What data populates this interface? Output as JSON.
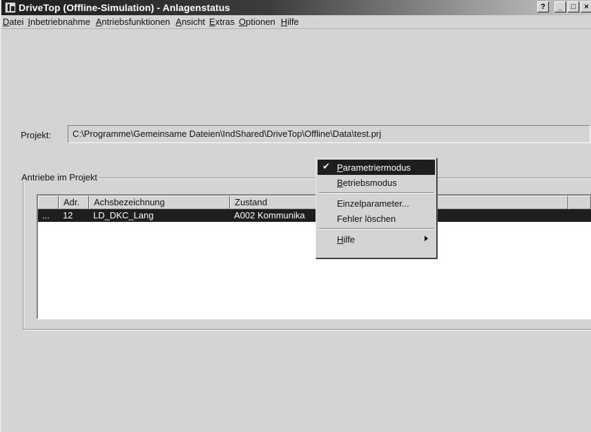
{
  "window": {
    "title": "DriveTop (Offline-Simulation) - Anlagenstatus",
    "controls": {
      "help": "?",
      "minimize": "_",
      "maximize": "□",
      "close": "×"
    }
  },
  "menubar": {
    "items": [
      "Datei",
      "Inbetriebnahme",
      "Antriebsfunktionen",
      "Ansicht",
      "Extras",
      "Optionen",
      "Hilfe"
    ]
  },
  "project": {
    "label": "Projekt:",
    "path": "C:\\Programme\\Gemeinsame Dateien\\IndShared\\DriveTop\\Offline\\Data\\test.prj"
  },
  "drives_group": {
    "title": "Antriebe im Projekt",
    "columns": [
      "",
      "Adr.",
      "Achsbezeichnung",
      "Zustand"
    ],
    "rows": [
      {
        "marker": "...",
        "addr": "12",
        "name": "LD_DKC_Lang",
        "status": "A002 Kommunika"
      }
    ]
  },
  "context_menu": {
    "items": [
      {
        "label": "Parametriermodus",
        "checked": true,
        "selected": true
      },
      {
        "label": "Betriebsmodus"
      },
      {
        "label": "Einzelparameter..."
      },
      {
        "label": "Fehler löschen"
      },
      {
        "label": "Hilfe",
        "submenu": true
      }
    ],
    "check_glyph": "✔"
  },
  "colors": {
    "selection": "#1e1e1e",
    "window_bg": "#d4d4d4"
  }
}
